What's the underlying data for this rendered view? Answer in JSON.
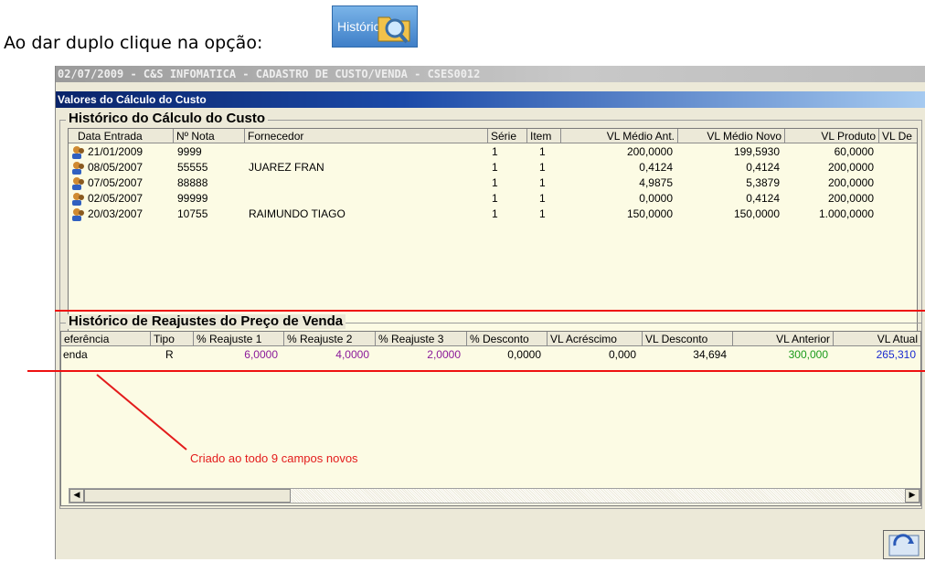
{
  "intro": {
    "text": "Ao dar duplo clique na opção:"
  },
  "historicos_button": {
    "label": "Históricos:"
  },
  "window": {
    "title": "02/07/2009 - C&S INFOMATICA - CADASTRO DE CUSTO/VENDA - CSES0012",
    "subtitle": "Valores do Cálculo do Custo"
  },
  "custo": {
    "title": "Histórico do Cálculo do Custo",
    "columns": [
      "Data Entrada",
      "Nº Nota",
      "Fornecedor",
      "Série",
      "Item",
      "VL Médio Ant.",
      "VL Médio Novo",
      "VL Produto",
      "VL De"
    ],
    "rows": [
      {
        "data": "21/01/2009",
        "nota": "9999",
        "fornecedor": "",
        "serie": "1",
        "item": "1",
        "medio_ant": "200,0000",
        "medio_novo": "199,5930",
        "produto": "60,0000"
      },
      {
        "data": "08/05/2007",
        "nota": "55555",
        "fornecedor": "JUAREZ FRAN",
        "serie": "1",
        "item": "1",
        "medio_ant": "0,4124",
        "medio_novo": "0,4124",
        "produto": "200,0000"
      },
      {
        "data": "07/05/2007",
        "nota": "88888",
        "fornecedor": "",
        "serie": "1",
        "item": "1",
        "medio_ant": "4,9875",
        "medio_novo": "5,3879",
        "produto": "200,0000"
      },
      {
        "data": "02/05/2007",
        "nota": "99999",
        "fornecedor": "",
        "serie": "1",
        "item": "1",
        "medio_ant": "0,0000",
        "medio_novo": "0,4124",
        "produto": "200,0000"
      },
      {
        "data": "20/03/2007",
        "nota": "10755",
        "fornecedor": "RAIMUNDO TIAGO",
        "serie": "1",
        "item": "1",
        "medio_ant": "150,0000",
        "medio_novo": "150,0000",
        "produto": "1.000,0000"
      }
    ]
  },
  "reajustes": {
    "title": "Histórico de Reajustes do Preço de Venda",
    "columns": [
      "eferência",
      "Tipo",
      "% Reajuste 1",
      "% Reajuste 2",
      "% Reajuste 3",
      "% Desconto",
      "VL Acréscimo",
      "VL Desconto",
      "VL Anterior",
      "VL Atual"
    ],
    "rows": [
      {
        "referencia": "enda",
        "tipo": "R",
        "reajuste1": "6,0000",
        "reajuste2": "4,0000",
        "reajuste3": "2,0000",
        "desconto": "0,0000",
        "acrescimo": "0,000",
        "vl_desconto": "34,694",
        "anterior": "300,000",
        "atual": "265,310"
      }
    ]
  },
  "annotation": {
    "text": "Criado ao todo 9 campos novos"
  },
  "colors": {
    "purple": "#8b1a9a",
    "green": "#1a9a1a",
    "blue": "#1a2ad0",
    "red": "#e31b1b"
  }
}
